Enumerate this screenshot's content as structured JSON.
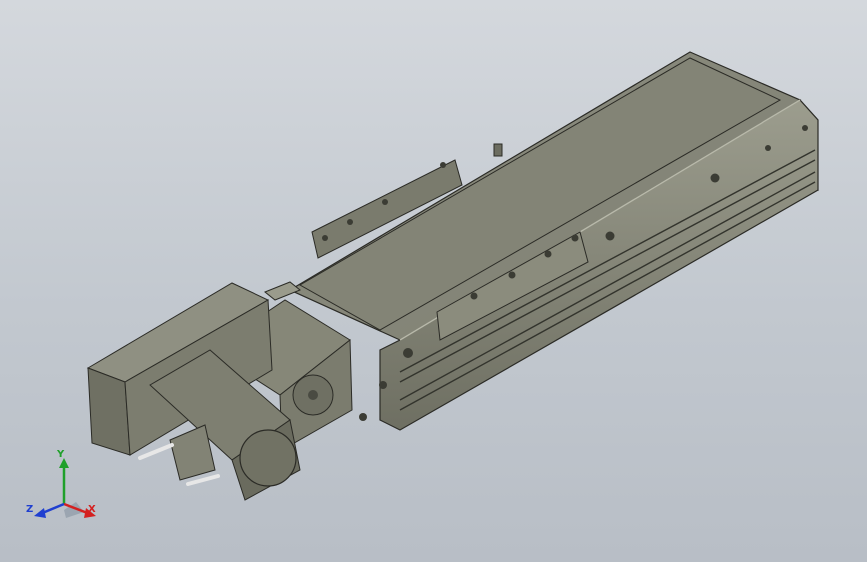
{
  "view": {
    "background_top": "#d4d8dd",
    "background_bottom": "#b8bec6"
  },
  "model": {
    "body_color": "#8a8b7c",
    "edge_color": "#2b2b26"
  },
  "triad": {
    "x_label": "X",
    "y_label": "Y",
    "z_label": "Z",
    "x_color": "#d42020",
    "y_color": "#1fa02a",
    "z_color": "#1f3fd0"
  }
}
